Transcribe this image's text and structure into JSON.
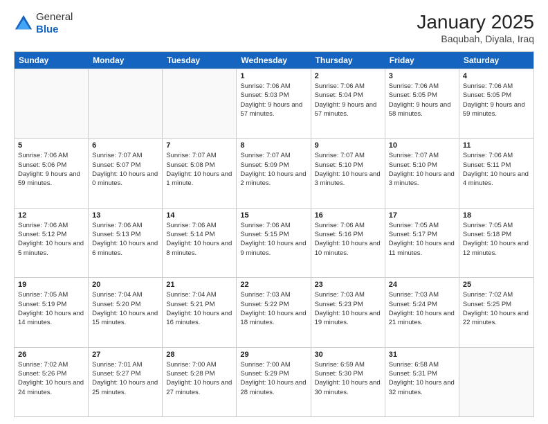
{
  "header": {
    "logo_general": "General",
    "logo_blue": "Blue",
    "month_title": "January 2025",
    "location": "Baqubah, Diyala, Iraq"
  },
  "days_of_week": [
    "Sunday",
    "Monday",
    "Tuesday",
    "Wednesday",
    "Thursday",
    "Friday",
    "Saturday"
  ],
  "weeks": [
    [
      {
        "day": "",
        "info": ""
      },
      {
        "day": "",
        "info": ""
      },
      {
        "day": "",
        "info": ""
      },
      {
        "day": "1",
        "info": "Sunrise: 7:06 AM\nSunset: 5:03 PM\nDaylight: 9 hours\nand 57 minutes."
      },
      {
        "day": "2",
        "info": "Sunrise: 7:06 AM\nSunset: 5:04 PM\nDaylight: 9 hours\nand 57 minutes."
      },
      {
        "day": "3",
        "info": "Sunrise: 7:06 AM\nSunset: 5:05 PM\nDaylight: 9 hours\nand 58 minutes."
      },
      {
        "day": "4",
        "info": "Sunrise: 7:06 AM\nSunset: 5:05 PM\nDaylight: 9 hours\nand 59 minutes."
      }
    ],
    [
      {
        "day": "5",
        "info": "Sunrise: 7:06 AM\nSunset: 5:06 PM\nDaylight: 9 hours\nand 59 minutes."
      },
      {
        "day": "6",
        "info": "Sunrise: 7:07 AM\nSunset: 5:07 PM\nDaylight: 10 hours\nand 0 minutes."
      },
      {
        "day": "7",
        "info": "Sunrise: 7:07 AM\nSunset: 5:08 PM\nDaylight: 10 hours\nand 1 minute."
      },
      {
        "day": "8",
        "info": "Sunrise: 7:07 AM\nSunset: 5:09 PM\nDaylight: 10 hours\nand 2 minutes."
      },
      {
        "day": "9",
        "info": "Sunrise: 7:07 AM\nSunset: 5:10 PM\nDaylight: 10 hours\nand 3 minutes."
      },
      {
        "day": "10",
        "info": "Sunrise: 7:07 AM\nSunset: 5:10 PM\nDaylight: 10 hours\nand 3 minutes."
      },
      {
        "day": "11",
        "info": "Sunrise: 7:06 AM\nSunset: 5:11 PM\nDaylight: 10 hours\nand 4 minutes."
      }
    ],
    [
      {
        "day": "12",
        "info": "Sunrise: 7:06 AM\nSunset: 5:12 PM\nDaylight: 10 hours\nand 5 minutes."
      },
      {
        "day": "13",
        "info": "Sunrise: 7:06 AM\nSunset: 5:13 PM\nDaylight: 10 hours\nand 6 minutes."
      },
      {
        "day": "14",
        "info": "Sunrise: 7:06 AM\nSunset: 5:14 PM\nDaylight: 10 hours\nand 8 minutes."
      },
      {
        "day": "15",
        "info": "Sunrise: 7:06 AM\nSunset: 5:15 PM\nDaylight: 10 hours\nand 9 minutes."
      },
      {
        "day": "16",
        "info": "Sunrise: 7:06 AM\nSunset: 5:16 PM\nDaylight: 10 hours\nand 10 minutes."
      },
      {
        "day": "17",
        "info": "Sunrise: 7:05 AM\nSunset: 5:17 PM\nDaylight: 10 hours\nand 11 minutes."
      },
      {
        "day": "18",
        "info": "Sunrise: 7:05 AM\nSunset: 5:18 PM\nDaylight: 10 hours\nand 12 minutes."
      }
    ],
    [
      {
        "day": "19",
        "info": "Sunrise: 7:05 AM\nSunset: 5:19 PM\nDaylight: 10 hours\nand 14 minutes."
      },
      {
        "day": "20",
        "info": "Sunrise: 7:04 AM\nSunset: 5:20 PM\nDaylight: 10 hours\nand 15 minutes."
      },
      {
        "day": "21",
        "info": "Sunrise: 7:04 AM\nSunset: 5:21 PM\nDaylight: 10 hours\nand 16 minutes."
      },
      {
        "day": "22",
        "info": "Sunrise: 7:03 AM\nSunset: 5:22 PM\nDaylight: 10 hours\nand 18 minutes."
      },
      {
        "day": "23",
        "info": "Sunrise: 7:03 AM\nSunset: 5:23 PM\nDaylight: 10 hours\nand 19 minutes."
      },
      {
        "day": "24",
        "info": "Sunrise: 7:03 AM\nSunset: 5:24 PM\nDaylight: 10 hours\nand 21 minutes."
      },
      {
        "day": "25",
        "info": "Sunrise: 7:02 AM\nSunset: 5:25 PM\nDaylight: 10 hours\nand 22 minutes."
      }
    ],
    [
      {
        "day": "26",
        "info": "Sunrise: 7:02 AM\nSunset: 5:26 PM\nDaylight: 10 hours\nand 24 minutes."
      },
      {
        "day": "27",
        "info": "Sunrise: 7:01 AM\nSunset: 5:27 PM\nDaylight: 10 hours\nand 25 minutes."
      },
      {
        "day": "28",
        "info": "Sunrise: 7:00 AM\nSunset: 5:28 PM\nDaylight: 10 hours\nand 27 minutes."
      },
      {
        "day": "29",
        "info": "Sunrise: 7:00 AM\nSunset: 5:29 PM\nDaylight: 10 hours\nand 28 minutes."
      },
      {
        "day": "30",
        "info": "Sunrise: 6:59 AM\nSunset: 5:30 PM\nDaylight: 10 hours\nand 30 minutes."
      },
      {
        "day": "31",
        "info": "Sunrise: 6:58 AM\nSunset: 5:31 PM\nDaylight: 10 hours\nand 32 minutes."
      },
      {
        "day": "",
        "info": ""
      }
    ]
  ]
}
